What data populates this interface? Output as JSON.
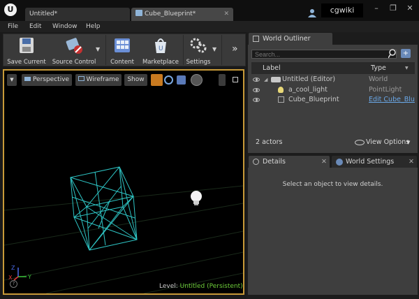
{
  "window": {
    "tabs": [
      {
        "label": "Untitled*"
      },
      {
        "label": "Cube_Blueprint*"
      }
    ],
    "user": "cgwiki"
  },
  "menu": [
    "File",
    "Edit",
    "Window",
    "Help"
  ],
  "toolbar": {
    "save_current": "Save Current",
    "source_control": "Source Control",
    "content": "Content",
    "marketplace": "Marketplace",
    "settings": "Settings"
  },
  "viewport": {
    "perspective": "Perspective",
    "wireframe": "Wireframe",
    "show": "Show",
    "level_label": "Level:",
    "level_value": "Untitled (Persistent)",
    "axis_z": "Z",
    "axis_x": "X",
    "axis_y": "Y"
  },
  "outliner": {
    "tab": "World Outliner",
    "search_placeholder": "Search...",
    "col_label": "Label",
    "col_type": "Type",
    "rows": [
      {
        "label": "Untitled (Editor)",
        "type": "World"
      },
      {
        "label": "a_cool_light",
        "type": "PointLight"
      },
      {
        "label": "Cube_Blueprint",
        "type": "Edit Cube_Blu"
      }
    ],
    "actors": "2 actors",
    "view_options": "View Options"
  },
  "details": {
    "tab": "Details",
    "world_settings_tab": "World Settings",
    "empty_message": "Select an object to view details."
  },
  "colors": {
    "viewport_border": "#c89a38",
    "wireframe": "#2ec4c4",
    "level_value": "#6fcf3a",
    "link": "#6aa8e8"
  }
}
